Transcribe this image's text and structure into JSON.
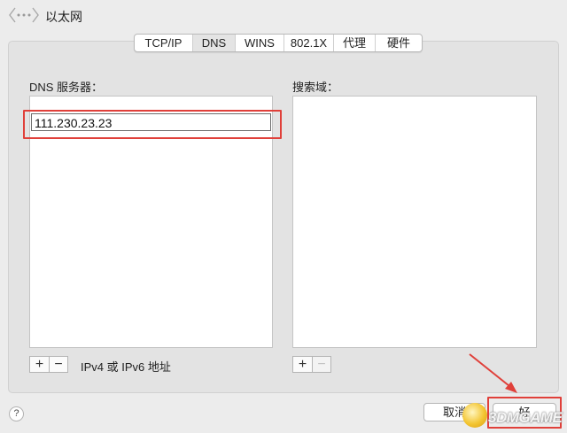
{
  "window": {
    "title": "以太网"
  },
  "icons": {
    "nav": "all-preferences-icon",
    "help": "help-icon",
    "add": "plus-icon",
    "remove": "minus-icon",
    "arrow": "annotation-arrow-icon"
  },
  "tabs": [
    {
      "label": "TCP/IP",
      "active": false
    },
    {
      "label": "DNS",
      "active": true
    },
    {
      "label": "WINS",
      "active": false
    },
    {
      "label": "802.1X",
      "active": false
    },
    {
      "label": "代理",
      "active": false
    },
    {
      "label": "硬件",
      "active": false
    }
  ],
  "dns": {
    "label": "DNS 服务器：",
    "servers": [
      "111.230.23.23"
    ],
    "add_symbol": "+",
    "remove_symbol": "−",
    "caption": "IPv4 或 IPv6 地址"
  },
  "search_domains": {
    "label": "搜索域：",
    "items": [],
    "add_symbol": "+",
    "remove_symbol": "−"
  },
  "footer": {
    "help_symbol": "?",
    "cancel_label": "取消",
    "ok_label": "好"
  },
  "watermark": {
    "text": "3DMGAME"
  },
  "colors": {
    "annotation": "#e0403a",
    "panel": "#e3e3e3",
    "background": "#ececec"
  }
}
